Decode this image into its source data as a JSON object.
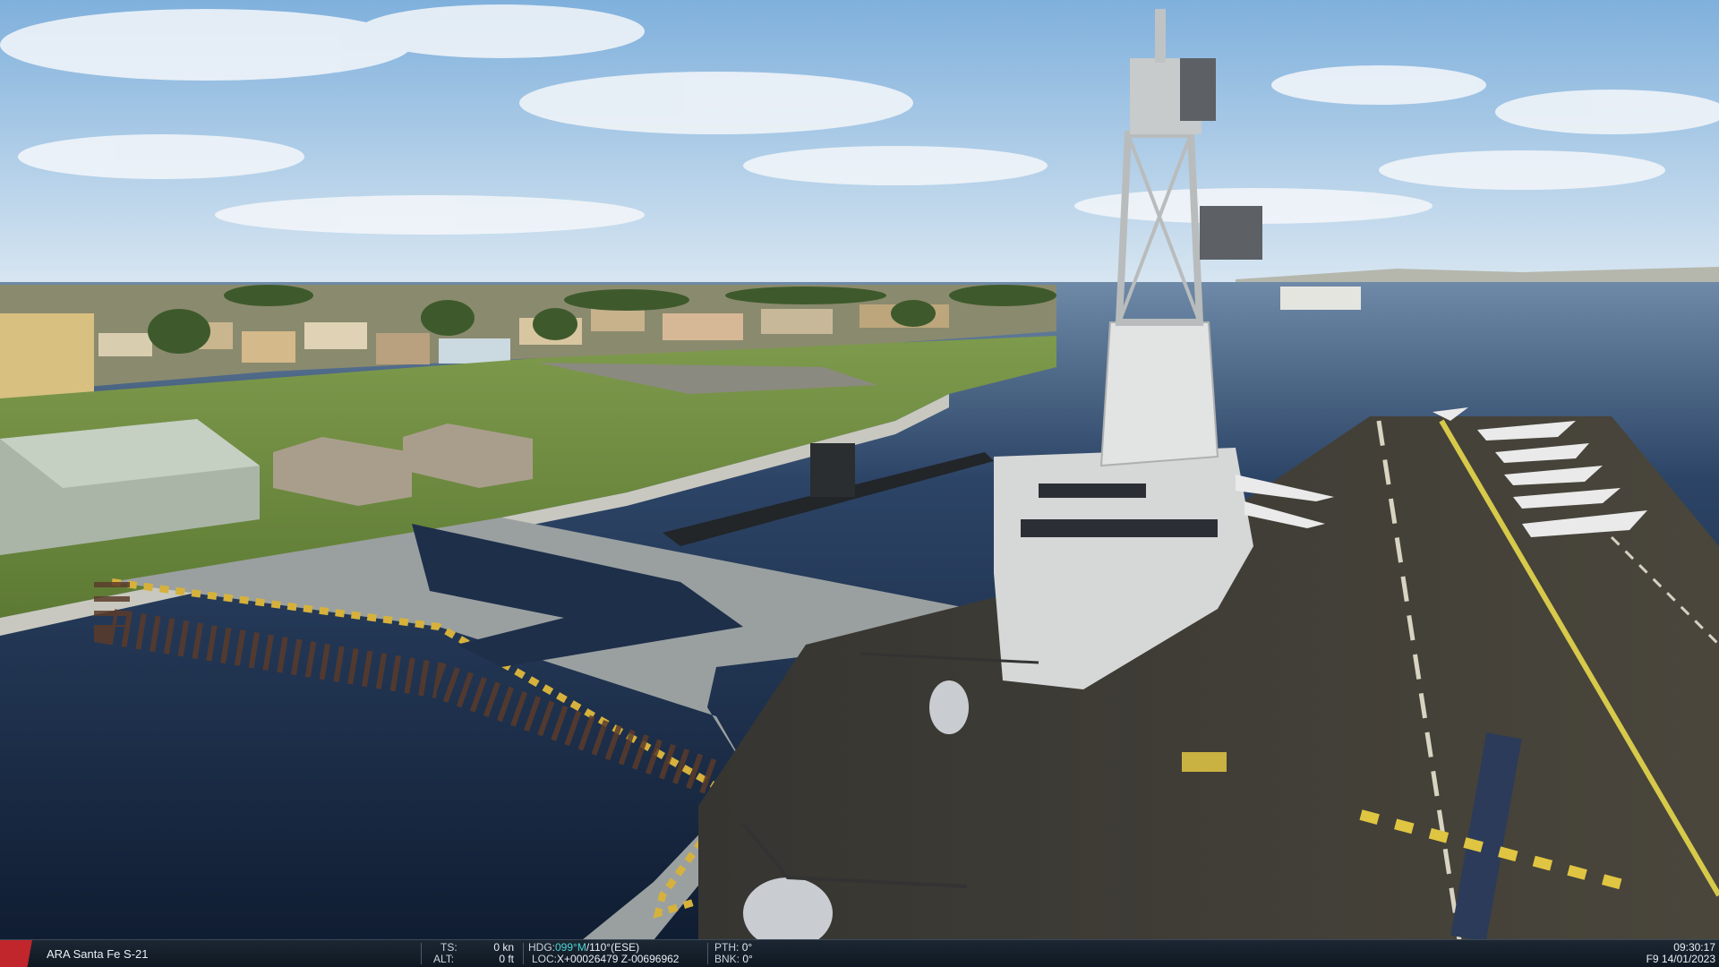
{
  "scene": {
    "description_icon": "aircraft-carrier-icon",
    "sky_color": "#9ec3e2",
    "water_color": "#1c2c45",
    "grass_color": "#6f8d3f",
    "deck_color": "#3a3935"
  },
  "hud": {
    "unit_name": "ARA Santa Fe S-21",
    "ts_label": "TS:",
    "ts_value": "0 kn",
    "alt_label": "ALT:",
    "alt_value": "0 ft",
    "hdg_label": "HDG:",
    "hdg_mag": "099°M",
    "hdg_true": "/110°(ESE)",
    "loc_label": "LOC:",
    "loc_value": "X+00026479 Z-00696962",
    "pth_label": "PTH:",
    "pth_value": "0°",
    "bnk_label": "BNK:",
    "bnk_value": "0°",
    "time": "09:30:17",
    "date_line": "F9 14/01/2023",
    "accent_color": "#4fd6d6",
    "flag_color": "#c0262b"
  }
}
